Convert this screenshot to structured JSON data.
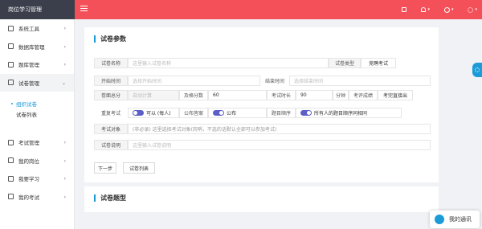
{
  "app": {
    "title": "岗位学习管理"
  },
  "sidebar": {
    "items": [
      {
        "label": "系统工具",
        "icon": "grid-icon"
      },
      {
        "label": "数据库管理",
        "icon": "database-icon"
      },
      {
        "label": "题库管理",
        "icon": "layers-icon"
      },
      {
        "label": "试卷管理",
        "icon": "document-icon",
        "expanded": true
      },
      {
        "label": "考试管理",
        "icon": "pen-icon"
      },
      {
        "label": "我的岗位",
        "icon": "briefcase-icon"
      },
      {
        "label": "我要学习",
        "icon": "book-icon"
      },
      {
        "label": "我的考试",
        "icon": "exam-icon"
      }
    ],
    "sub_items": [
      {
        "label": "组织试卷",
        "active": true
      },
      {
        "label": "试卷列表",
        "active": false
      }
    ]
  },
  "form": {
    "section_title": "试卷参数",
    "name_label": "试卷名称",
    "name_placeholder": "这里输入试卷名称",
    "type_label": "试卷类型",
    "type_value": "竞聘考试",
    "start_label": "开始时间",
    "start_placeholder": "选择开始时间",
    "end_label": "结束时间",
    "end_placeholder": "选择结束时间",
    "total_label": "卷面总分",
    "total_placeholder": "自动计算",
    "pass_label": "及格分数",
    "pass_value": "60",
    "duration_label": "考试时长",
    "duration_value": "90",
    "duration_unit": "分钟",
    "review_label": "考评成绩",
    "review_value": "考完直接出",
    "retake_label": "重复考试",
    "retake_value": "可以 (每人)",
    "publish_label": "公布答案",
    "publish_value": "公布",
    "order_label": "题目顺序",
    "order_value": "所有人的题目顺序同相同",
    "target_label": "考试对象",
    "target_placeholder": "(非必录) 这里选择考试对象(岗哨，不选的话默认全部可以参加考试)",
    "desc_label": "试卷说明",
    "desc_placeholder": "这里输入试卷说明",
    "next_button": "下一步",
    "list_button": "试卷列表"
  },
  "section2": {
    "title": "试卷题型"
  },
  "chat": {
    "label": "我的通讯"
  }
}
